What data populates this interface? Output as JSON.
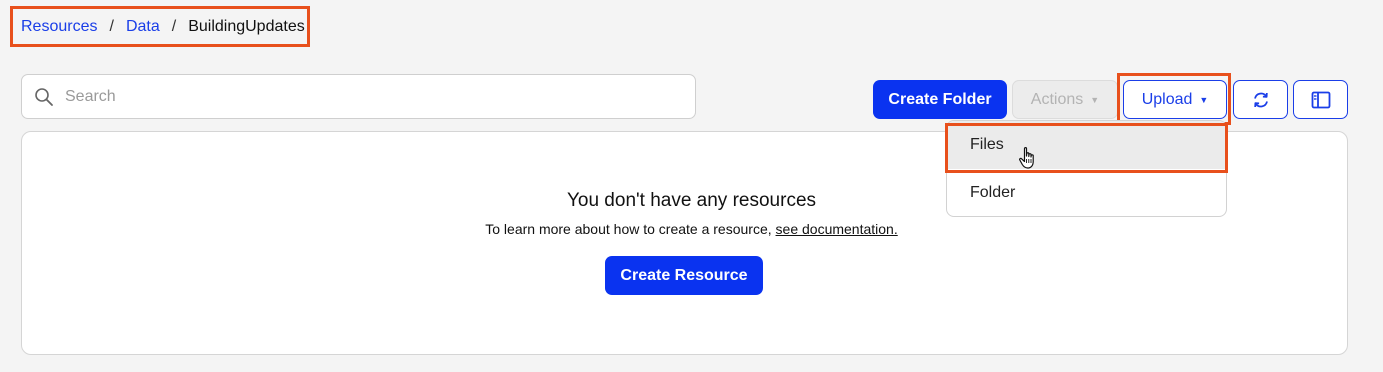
{
  "breadcrumb": {
    "items": [
      "Resources",
      "Data"
    ],
    "separator": "/",
    "current": "BuildingUpdates"
  },
  "search": {
    "placeholder": "Search",
    "value": "",
    "icon": "search-icon"
  },
  "toolbar": {
    "create_folder_label": "Create Folder",
    "actions_label": "Actions",
    "upload_label": "Upload",
    "refresh_icon": "refresh-icon",
    "panel_icon": "panel-layout-icon"
  },
  "upload_menu": {
    "items": [
      "Files",
      "Folder"
    ],
    "hovered": "Files"
  },
  "empty_state": {
    "title": "You don't have any resources",
    "text": "To learn more about how to create a resource, ",
    "link": "see documentation.",
    "button": "Create Resource"
  },
  "colors": {
    "primary": "#0a33f0",
    "link": "#1a3ee8",
    "highlight": "#e8501c",
    "background": "#f4f4f4"
  }
}
